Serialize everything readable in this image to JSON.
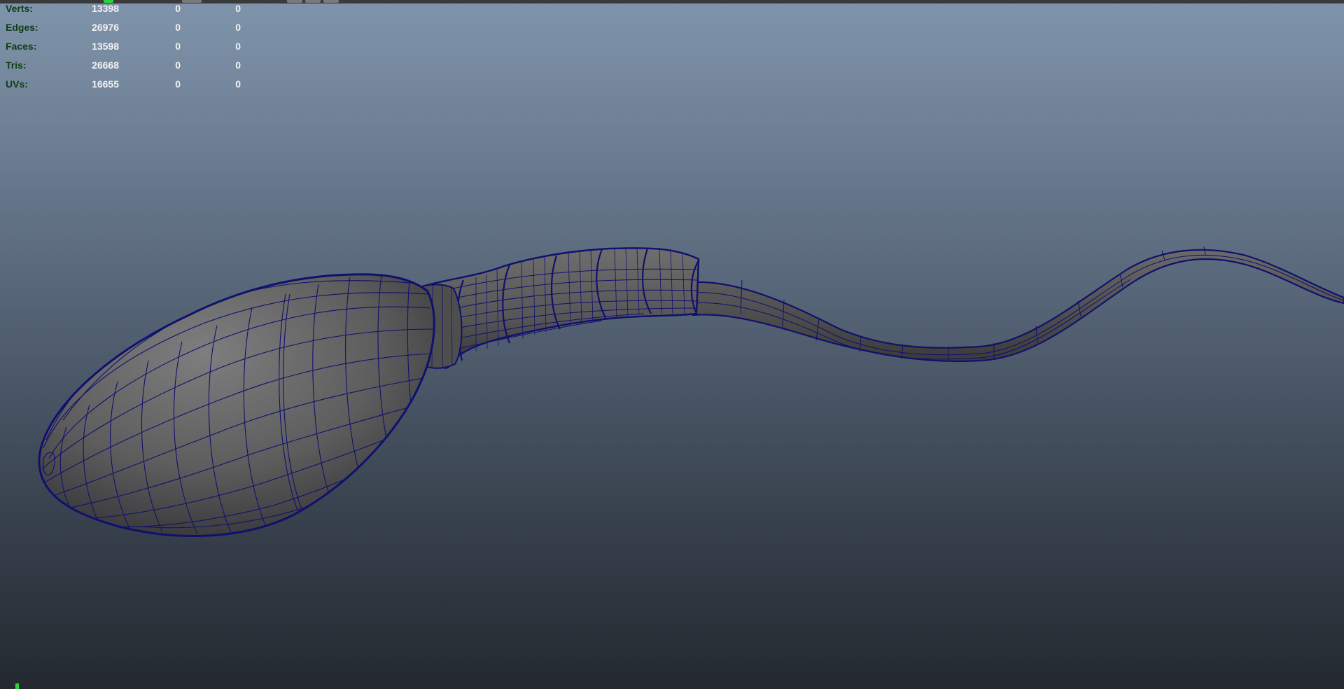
{
  "hud": {
    "rows": [
      {
        "label": "Verts:",
        "values": [
          "13398",
          "0",
          "0"
        ]
      },
      {
        "label": "Edges:",
        "values": [
          "26976",
          "0",
          "0"
        ]
      },
      {
        "label": "Faces:",
        "values": [
          "13598",
          "0",
          "0"
        ]
      },
      {
        "label": "Tris:",
        "values": [
          "26668",
          "0",
          "0"
        ]
      },
      {
        "label": "UVs:",
        "values": [
          "16655",
          "0",
          "0"
        ]
      }
    ]
  },
  "colors": {
    "hud_label": "#0d3d16",
    "hud_value": "#f2f2f2",
    "wireframe": "#10106e",
    "mesh": "#5a5a5a",
    "axis_marker": "#2bd23a"
  },
  "icons": {
    "top_strip": "toolbar-strip",
    "axis": "axis-icon"
  }
}
